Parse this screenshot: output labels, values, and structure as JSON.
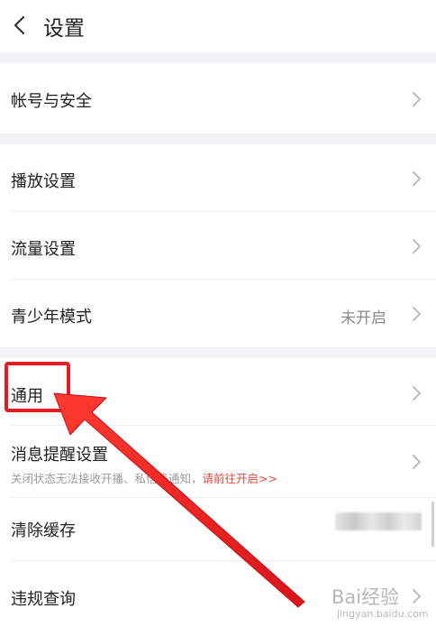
{
  "header": {
    "title": "设置",
    "back_icon": "chevron-left-icon"
  },
  "groups": {
    "account": {
      "label": "帐号与安全"
    },
    "playback": {
      "label": "播放设置"
    },
    "data_usage": {
      "label": "流量设置"
    },
    "teen_mode": {
      "label": "青少年模式",
      "value": "未开启"
    },
    "general": {
      "label": "通用"
    },
    "notifications": {
      "label": "消息提醒设置",
      "subtext": "关闭状态无法接收开播、私信等通知，",
      "link": "请前往开启>>"
    },
    "clear_cache": {
      "label": "清除缓存"
    },
    "violation_query": {
      "label": "违规查询"
    }
  },
  "watermark": {
    "line1": "Bai经验",
    "line2": "jingyan.baidu.com"
  },
  "colors": {
    "background": "#ffffff",
    "section_gap": "#f2f3f5",
    "text": "#222222",
    "muted": "#8a8a8a",
    "link": "#e0483c",
    "annotation_red": "#e51c23"
  }
}
